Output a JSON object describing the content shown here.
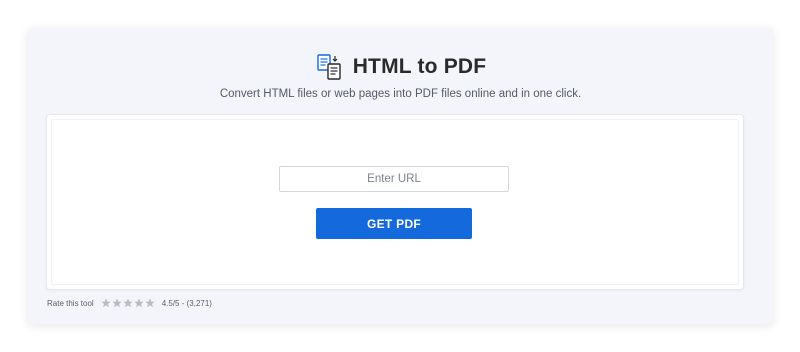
{
  "header": {
    "title": "HTML to PDF",
    "subtitle": "Convert HTML files or web pages into PDF files online and in one click.",
    "icon": "html-to-pdf-icon"
  },
  "form": {
    "url_placeholder": "Enter URL",
    "url_value": "",
    "submit_label": "GET PDF"
  },
  "rating": {
    "label": "Rate this tool",
    "stars_total": 5,
    "score_text": "4.5/5 - (3,271)"
  },
  "colors": {
    "accent": "#1469dc",
    "panel_bg": "#f4f5fa",
    "star": "#b9bcc3"
  }
}
